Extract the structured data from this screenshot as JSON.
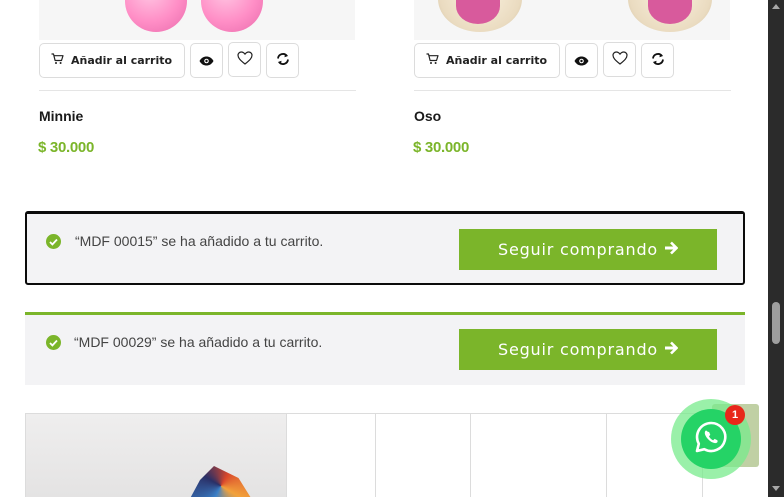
{
  "products": [
    {
      "name": "Minnie",
      "price": "$ 30.000",
      "add_to_cart_label": "Añadir al carrito"
    },
    {
      "name": "Oso",
      "price": "$ 30.000",
      "add_to_cart_label": "Añadir al carrito"
    }
  ],
  "notices": [
    {
      "message": "“MDF 00015” se ha añadido a tu carrito.",
      "button_label": "Seguir comprando"
    },
    {
      "message": "“MDF 00029” se ha añadido a tu carrito.",
      "button_label": "Seguir comprando"
    }
  ],
  "whatsapp": {
    "badge_count": "1"
  },
  "colors": {
    "accent_green": "#7bb52a",
    "whatsapp_green": "#25d366",
    "badge_red": "#e8271a"
  },
  "icons": {
    "cart": "cart-icon",
    "view": "eye-icon",
    "wishlist": "heart-icon",
    "compare": "refresh-icon",
    "success": "check-circle-icon",
    "arrow": "arrow-right-icon",
    "whatsapp": "whatsapp-icon"
  }
}
